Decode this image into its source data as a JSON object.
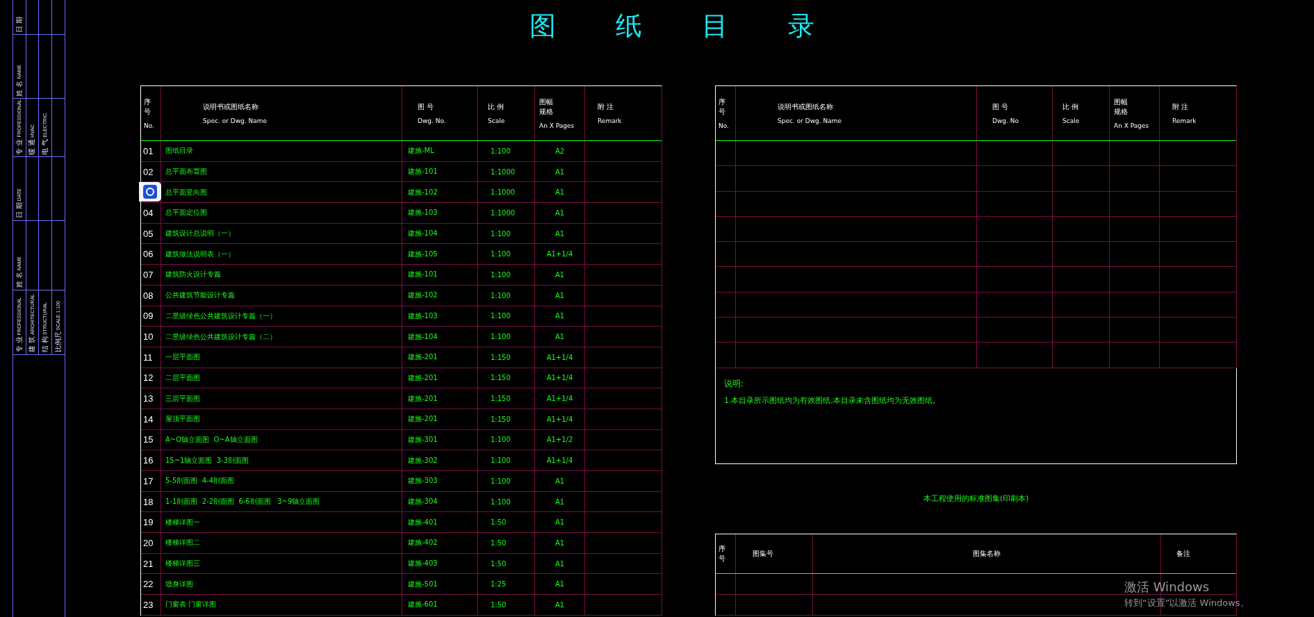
{
  "title_block": {
    "bands": [
      {
        "cells": [
          {
            "cn": "日 期"
          }
        ]
      },
      {
        "cells": [
          {
            "cn": "姓 名",
            "en": "NAME"
          }
        ]
      },
      {
        "cells": [
          {
            "cn": "专 业",
            "en": "PROFESSIONAL"
          },
          {
            "cn": "暖 通",
            "en": "HVAC"
          },
          {
            "cn": "电 气",
            "en": "ELECTRIC"
          }
        ]
      },
      {
        "cells": [
          {
            "cn": "日 期",
            "en": "DATE"
          }
        ]
      },
      {
        "cells": [
          {
            "cn": "姓 名",
            "en": "NAME"
          }
        ]
      },
      {
        "cells": [
          {
            "cn": "专 业",
            "en": "PROFESSIONAL"
          },
          {
            "cn": "建 筑",
            "en": "ARCHITECTURAL"
          },
          {
            "cn": "结 构",
            "en": "STRUCTURAL"
          },
          {
            "cn": "比例尺",
            "en": "SCALE 1:100"
          }
        ]
      }
    ]
  },
  "drawing_title": [
    "图",
    "纸",
    "目",
    "录"
  ],
  "index_table": {
    "headers": [
      {
        "cn": "序号",
        "en": "No."
      },
      {
        "cn": "说明书或图纸名称",
        "en": "Spec. or Dwg. Name"
      },
      {
        "cn": "图 号",
        "en": "Dwg. No."
      },
      {
        "cn": "比 例",
        "en": "Scale"
      },
      {
        "cn": "图幅规格",
        "en": "An X Pages"
      },
      {
        "cn": "附 注",
        "en": "Remark"
      }
    ],
    "rows": [
      {
        "no": "01",
        "name": "图纸目录",
        "dwg_no": "建施-ML",
        "scale": "1:100",
        "size": "A2"
      },
      {
        "no": "02",
        "name": "总平面布置图",
        "dwg_no": "建施-101",
        "scale": "1:1000",
        "size": "A1"
      },
      {
        "name": "总平面竖向图",
        "dwg_no": "建施-102",
        "scale": "1:1000",
        "size": "A1"
      },
      {
        "no": "04",
        "name": "总平面定位图",
        "dwg_no": "建施-103",
        "scale": "1:1000",
        "size": "A1"
      },
      {
        "no": "05",
        "name": "建筑设计总说明（一）",
        "dwg_no": "建施-104",
        "scale": "1:100",
        "size": "A1"
      },
      {
        "no": "06",
        "name": "建筑做法说明表（一）",
        "dwg_no": "建施-105",
        "scale": "1:100",
        "size": "A1+1/4"
      },
      {
        "no": "07",
        "name": "建筑防火设计专篇",
        "dwg_no": "建施-101",
        "scale": "1:100",
        "size": "A1"
      },
      {
        "no": "08",
        "name": "公共建筑节能设计专篇",
        "dwg_no": "建施-102",
        "scale": "1:100",
        "size": "A1"
      },
      {
        "no": "09",
        "name": "二星级绿色公共建筑设计专篇（一）",
        "dwg_no": "建施-103",
        "scale": "1:100",
        "size": "A1"
      },
      {
        "no": "10",
        "name": "二星级绿色公共建筑设计专篇（二）",
        "dwg_no": "建施-104",
        "scale": "1:100",
        "size": "A1"
      },
      {
        "no": "11",
        "name": "一层平面图",
        "dwg_no": "建施-201",
        "scale": "1:150",
        "size": "A1+1/4"
      },
      {
        "no": "12",
        "name": "二层平面图",
        "dwg_no": "建施-201",
        "scale": "1:150",
        "size": "A1+1/4"
      },
      {
        "no": "13",
        "name": "三层平面图",
        "dwg_no": "建施-201",
        "scale": "1:150",
        "size": "A1+1/4"
      },
      {
        "no": "14",
        "name": "屋顶平面图",
        "dwg_no": "建施-201",
        "scale": "1:150",
        "size": "A1+1/4"
      },
      {
        "no": "15",
        "name": "A~O轴立面图  O~A轴立面图",
        "dwg_no": "建施-301",
        "scale": "1:100",
        "size": "A1+1/2"
      },
      {
        "no": "16",
        "name": "15~1轴立面图  3-3剖面图",
        "dwg_no": "建施-302",
        "scale": "1:100",
        "size": "A1+1/4"
      },
      {
        "no": "17",
        "name": "5-5剖面图  4-4剖面图",
        "dwg_no": "建施-303",
        "scale": "1:100",
        "size": "A1"
      },
      {
        "no": "18",
        "name": "1-1剖面图  2-2剖面图  6-6剖面图   3~9轴立面图",
        "dwg_no": "建施-304",
        "scale": "1:100",
        "size": "A1"
      },
      {
        "no": "19",
        "name": "楼梯详图一",
        "dwg_no": "建施-401",
        "scale": "1:50",
        "size": "A1"
      },
      {
        "no": "20",
        "name": "楼梯详图二",
        "dwg_no": "建施-402",
        "scale": "1:50",
        "size": "A1"
      },
      {
        "no": "21",
        "name": "楼梯详图三",
        "dwg_no": "建施-403",
        "scale": "1:50",
        "size": "A1"
      },
      {
        "no": "22",
        "name": "墙身详图",
        "dwg_no": "建施-501",
        "scale": "1:25",
        "size": "A1"
      },
      {
        "no": "23",
        "name": "门窗表 门窗详图",
        "dwg_no": "建施-601",
        "scale": "1:50",
        "size": "A1"
      }
    ]
  },
  "continuation_table": {
    "headers": [
      {
        "cn": "序号",
        "en": "No."
      },
      {
        "cn": "说明书或图纸名称",
        "en": "Spec. or Dwg. Name"
      },
      {
        "cn": "图 号",
        "en": "Dwg. No"
      },
      {
        "cn": "比 例",
        "en": "Scale"
      },
      {
        "cn": "图幅规格",
        "en": "An X Pages"
      },
      {
        "cn": "附 注",
        "en": "Remark"
      }
    ]
  },
  "notes": {
    "heading": "说明:",
    "lines": [
      "1.本目录所示图纸均为有效图纸,本目录未含图纸均为无效图纸。"
    ]
  },
  "standard_atlas": {
    "title": "本工程使用的标准图集(印刷本)",
    "headers": [
      "序号",
      "图集号",
      "图集名称",
      "备注"
    ]
  },
  "os_notice": {
    "title": "激活 Windows",
    "subtitle": "转到“设置”以激活 Windows。"
  }
}
